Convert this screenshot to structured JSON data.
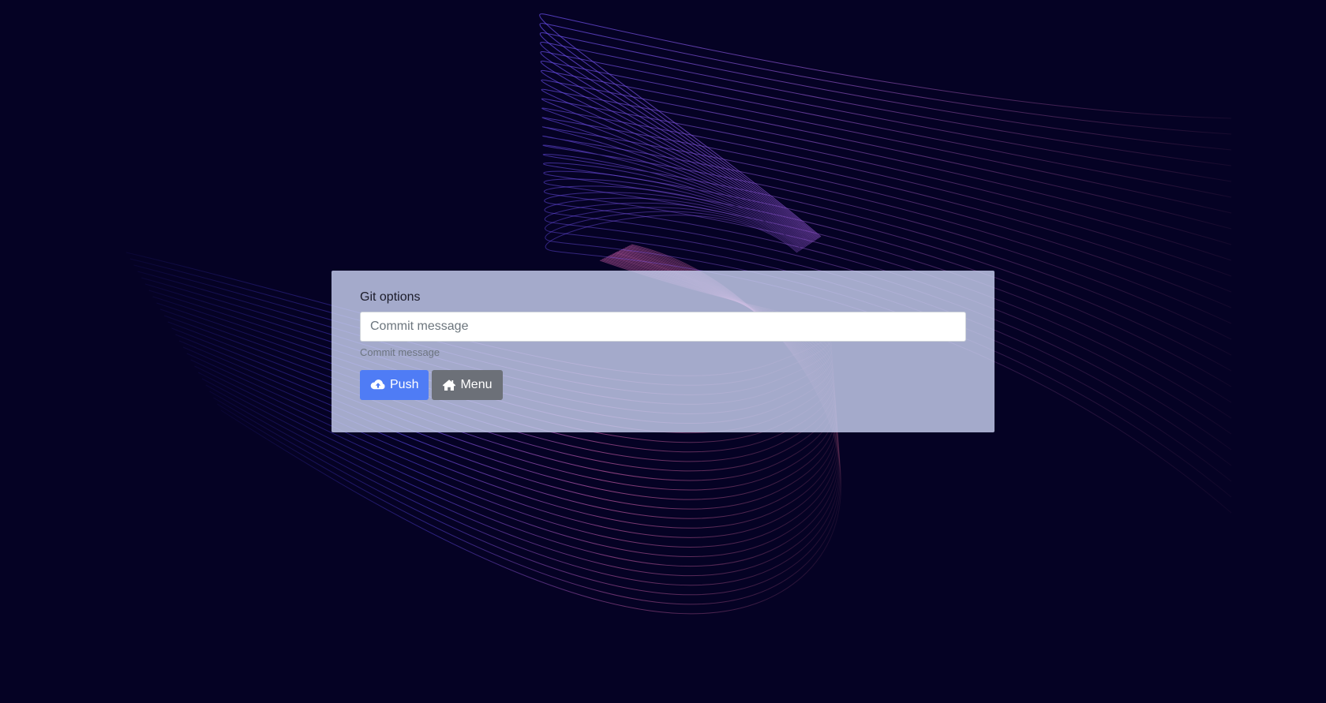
{
  "git_form": {
    "title": "Git options",
    "commit_input": {
      "placeholder": "Commit message",
      "value": ""
    },
    "help_text": "Commit message",
    "push_button": {
      "label": "Push",
      "icon": "cloud-upload-icon"
    },
    "menu_button": {
      "label": "Menu",
      "icon": "home-icon"
    }
  },
  "theme": {
    "background": "#050224",
    "panel_background": "#c8d0f0",
    "primary": "#4f7cf5",
    "secondary": "#6c7078",
    "wave_colors": [
      "#4a3be0",
      "#d8609a"
    ]
  }
}
